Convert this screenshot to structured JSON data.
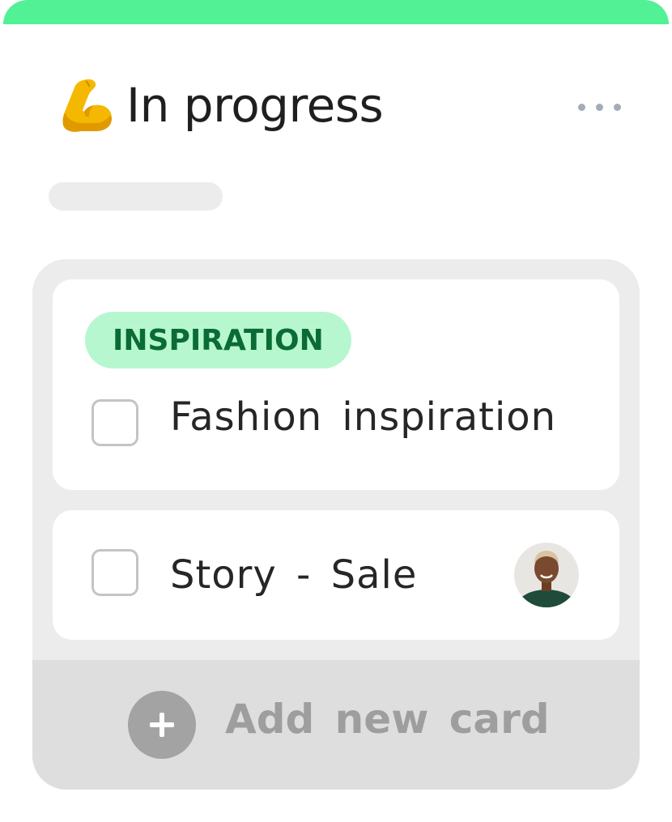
{
  "column": {
    "title": "In progress",
    "title_icon": "flexed-biceps-emoji",
    "menu_icon": "more-horizontal-icon",
    "accent_color": "#52f195"
  },
  "cards": [
    {
      "tag": "INSPIRATION",
      "tag_color": "#b6f7d0",
      "title": "Fashion inspiration",
      "checked": false
    },
    {
      "title": "Story - Sale",
      "checked": false,
      "assignee_icon": "avatar"
    }
  ],
  "add_card": {
    "label": "Add new card",
    "icon": "plus-circle-icon"
  }
}
